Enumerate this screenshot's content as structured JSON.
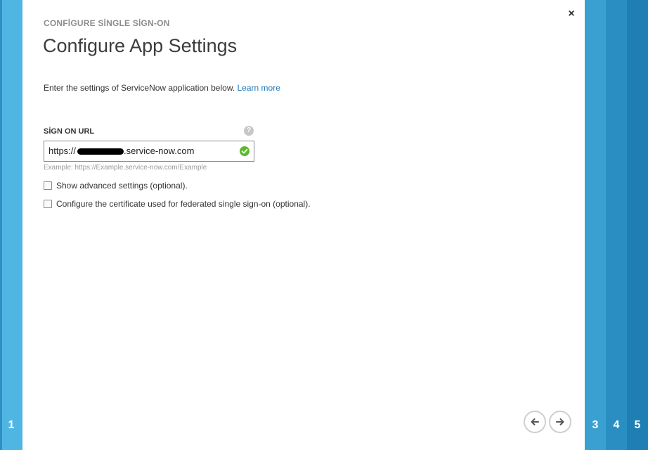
{
  "wizard": {
    "subtitle": "CONFİGURE SİNGLE SİGN-ON",
    "title": "Configure App Settings",
    "intro_text": "Enter the settings of ServiceNow application below.",
    "learn_more": "Learn more",
    "close_label": "×"
  },
  "steps": {
    "left": "1",
    "right": [
      "3",
      "4",
      "5"
    ]
  },
  "sign_on_url": {
    "label": "SİGN ON URL",
    "value_prefix": "https://",
    "value_suffix": ".service-now.com",
    "example": "Example: https://Example.service-now.com/Example",
    "status_icon": "check-circle-icon"
  },
  "options": [
    {
      "label": "Show advanced settings (optional).",
      "checked": false
    },
    {
      "label": "Configure the certificate used for federated single sign-on (optional).",
      "checked": false
    }
  ],
  "colors": {
    "left_rail": "#4fb6e3",
    "step3": "#3aa0d1",
    "step4": "#2a8ec2",
    "step5": "#1f7fb4",
    "link": "#1e7bbf",
    "valid": "#5cb82c"
  }
}
